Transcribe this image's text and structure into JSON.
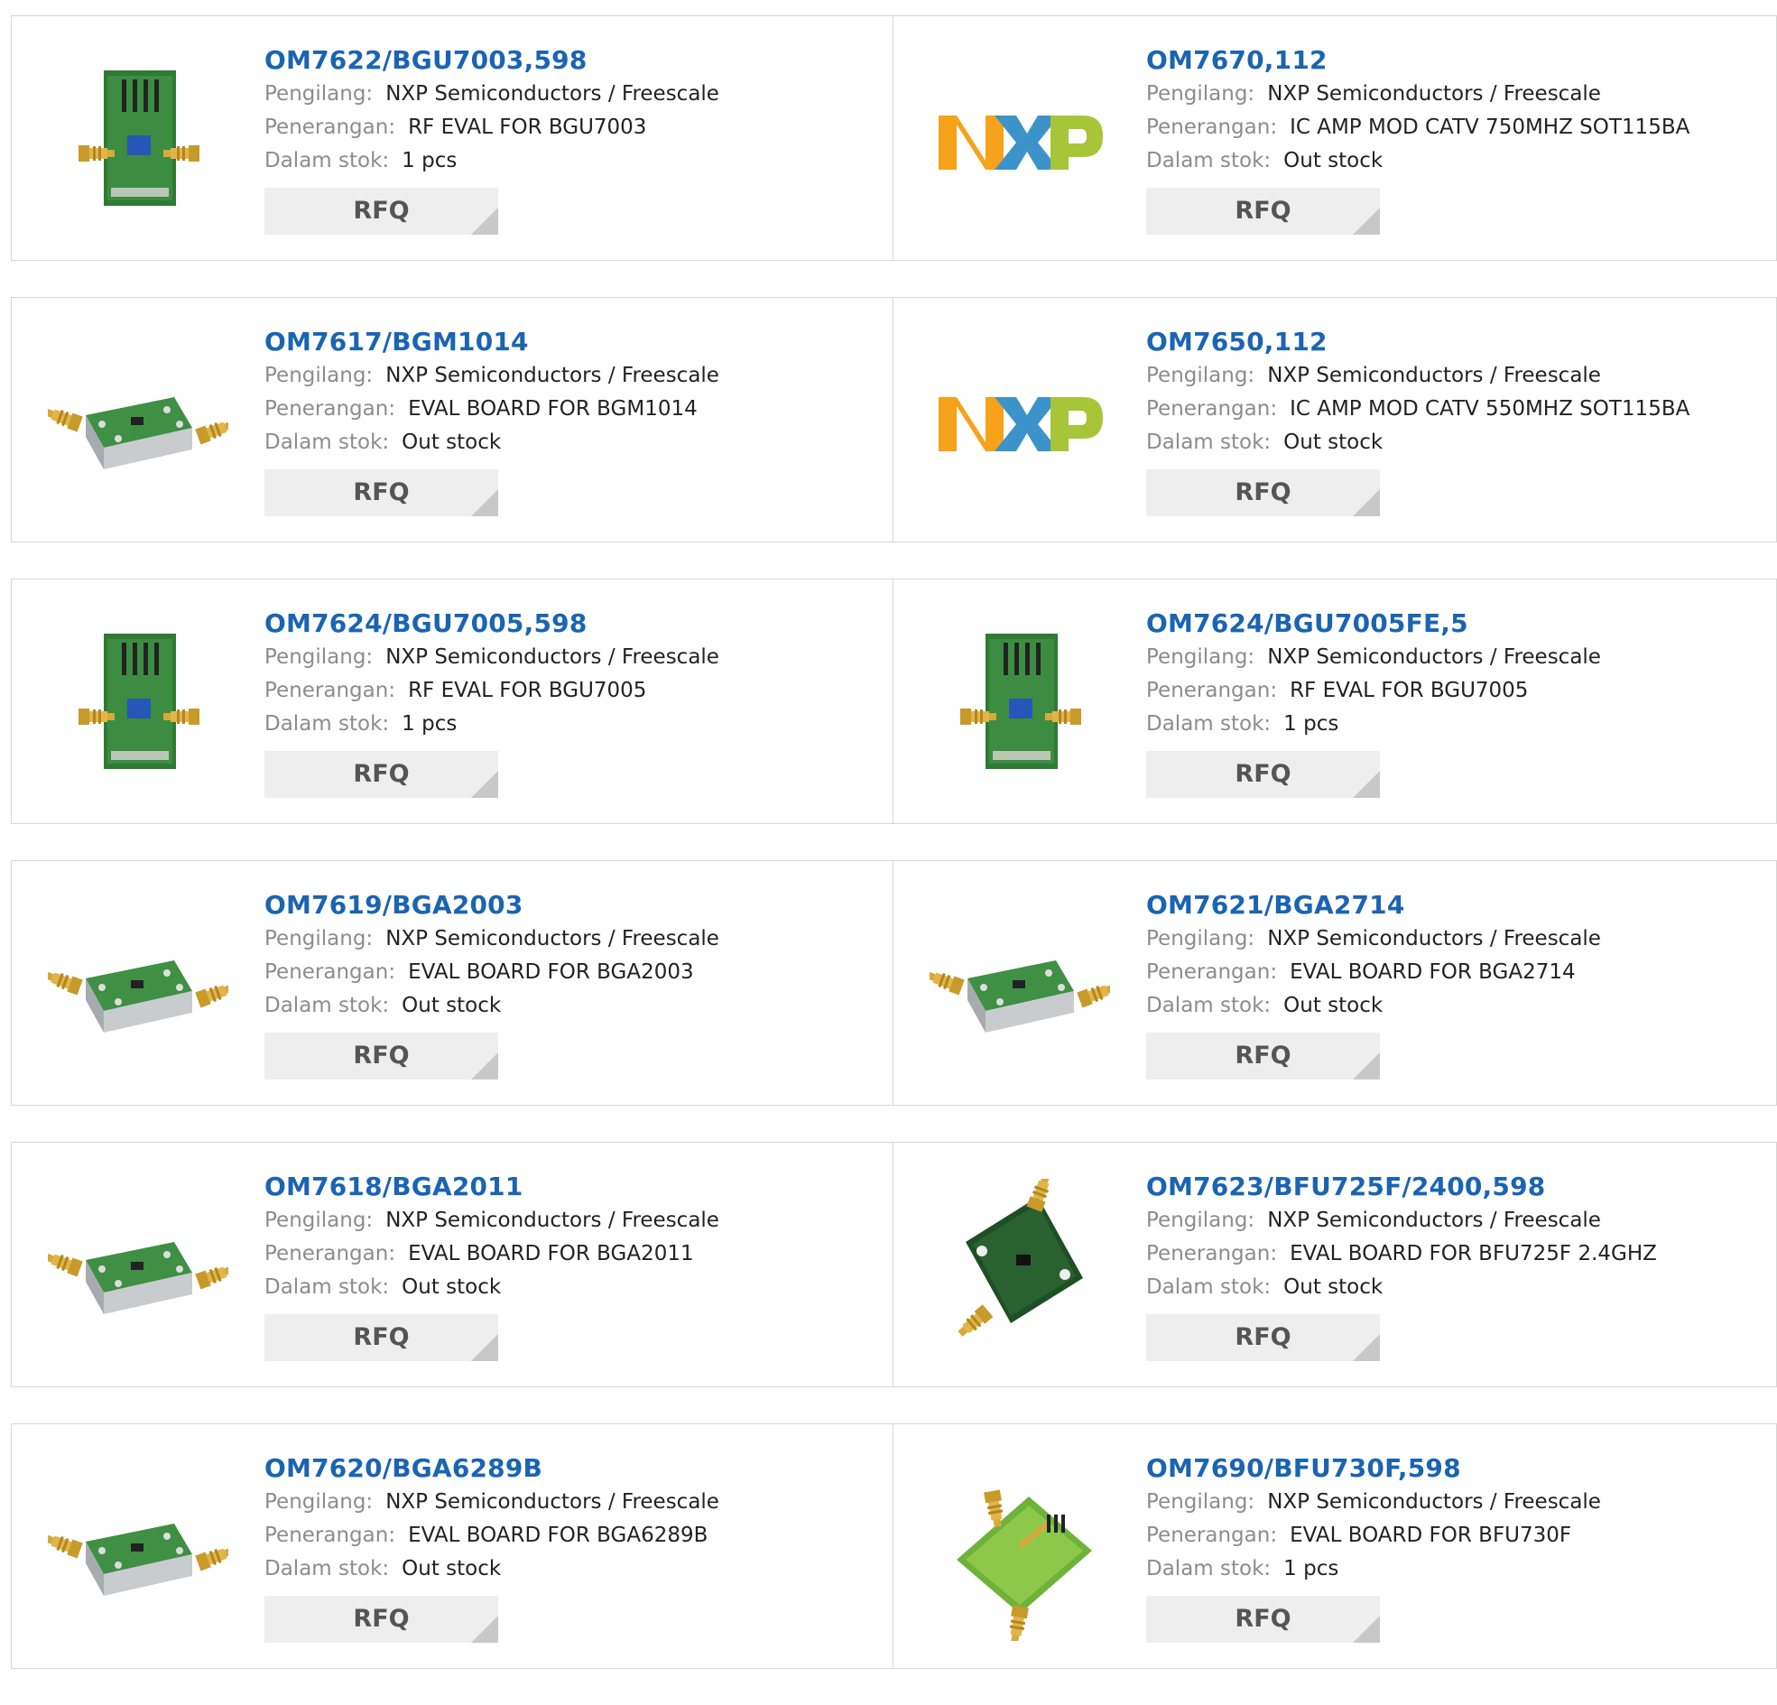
{
  "labels": {
    "manufacturer": "Pengilang:",
    "description": "Penerangan:",
    "stock": "Dalam stok:",
    "rfq": "RFQ"
  },
  "products": [
    {
      "part": "OM7622/BGU7003,598",
      "manufacturer": "NXP Semiconductors / Freescale",
      "description": "RF EVAL FOR BGU7003",
      "stock": "1 pcs",
      "image": "pcb-vertical-header-icon"
    },
    {
      "part": "OM7670,112",
      "manufacturer": "NXP Semiconductors / Freescale",
      "description": "IC AMP MOD CATV 750MHZ SOT115BA",
      "stock": "Out stock",
      "image": "nxp-logo"
    },
    {
      "part": "OM7617/BGM1014",
      "manufacturer": "NXP Semiconductors / Freescale",
      "description": "EVAL BOARD FOR BGM1014",
      "stock": "Out stock",
      "image": "metal-block-board-icon"
    },
    {
      "part": "OM7650,112",
      "manufacturer": "NXP Semiconductors / Freescale",
      "description": "IC AMP MOD CATV 550MHZ SOT115BA",
      "stock": "Out stock",
      "image": "nxp-logo"
    },
    {
      "part": "OM7624/BGU7005,598",
      "manufacturer": "NXP Semiconductors / Freescale",
      "description": "RF EVAL FOR BGU7005",
      "stock": "1 pcs",
      "image": "pcb-vertical-header-icon"
    },
    {
      "part": "OM7624/BGU7005FE,5",
      "manufacturer": "NXP Semiconductors / Freescale",
      "description": "RF EVAL FOR BGU7005",
      "stock": "1 pcs",
      "image": "pcb-vertical-header-icon"
    },
    {
      "part": "OM7619/BGA2003",
      "manufacturer": "NXP Semiconductors / Freescale",
      "description": "EVAL BOARD FOR BGA2003",
      "stock": "Out stock",
      "image": "metal-block-board-icon"
    },
    {
      "part": "OM7621/BGA2714",
      "manufacturer": "NXP Semiconductors / Freescale",
      "description": "EVAL BOARD FOR BGA2714",
      "stock": "Out stock",
      "image": "metal-block-board-icon"
    },
    {
      "part": "OM7618/BGA2011",
      "manufacturer": "NXP Semiconductors / Freescale",
      "description": "EVAL BOARD FOR BGA2011",
      "stock": "Out stock",
      "image": "metal-block-board-icon"
    },
    {
      "part": "OM7623/BFU725F/2400,598",
      "manufacturer": "NXP Semiconductors / Freescale",
      "description": "EVAL BOARD FOR BFU725F 2.4GHZ",
      "stock": "Out stock",
      "image": "dark-pcb-diagonal-icon"
    },
    {
      "part": "OM7620/BGA6289B",
      "manufacturer": "NXP Semiconductors / Freescale",
      "description": "EVAL BOARD FOR BGA6289B",
      "stock": "Out stock",
      "image": "metal-block-board-icon"
    },
    {
      "part": "OM7690/BFU730F,598",
      "manufacturer": "NXP Semiconductors / Freescale",
      "description": "EVAL BOARD FOR BFU730F",
      "stock": "1 pcs",
      "image": "green-pcb-diagonal-icon"
    }
  ],
  "colors": {
    "link": "#1a64b3",
    "label": "#8c8c8c",
    "border": "#d7d7d7",
    "button_bg": "#eeeeee",
    "nxp_orange": "#f6a21a",
    "nxp_blue": "#3b93c9",
    "nxp_green": "#a7c539"
  }
}
